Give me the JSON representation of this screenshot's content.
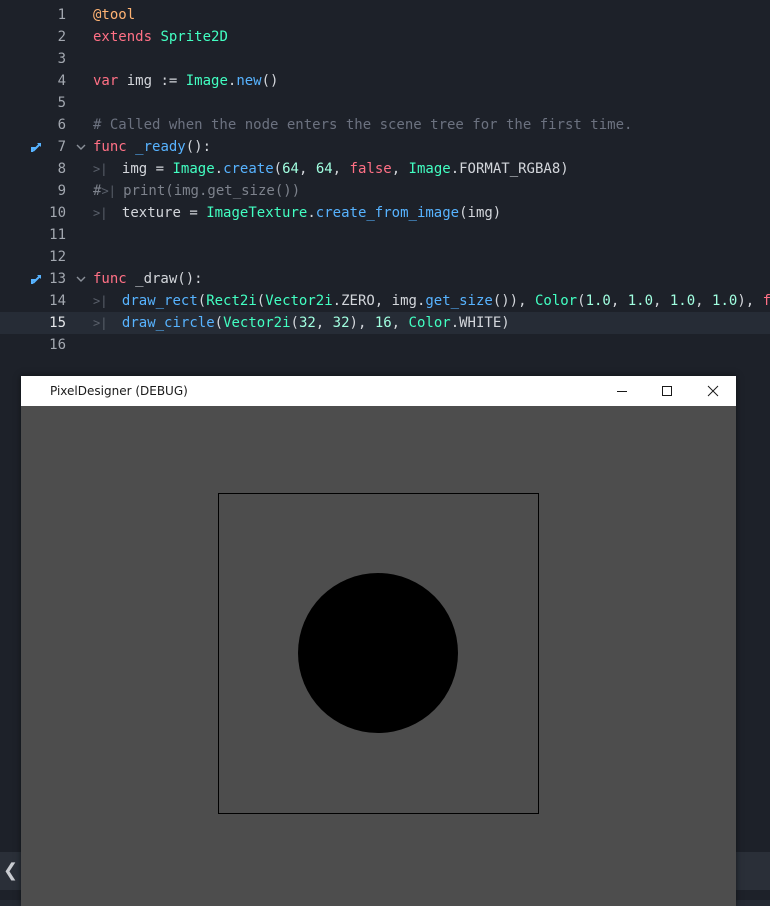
{
  "editor": {
    "lines": [
      {
        "n": "1",
        "tokens": [
          {
            "c": "an",
            "t": "@tool"
          }
        ]
      },
      {
        "n": "2",
        "tokens": [
          {
            "c": "kw",
            "t": "extends"
          },
          {
            "c": "pl",
            "t": " "
          },
          {
            "c": "ty",
            "t": "Sprite2D"
          }
        ]
      },
      {
        "n": "3",
        "tokens": []
      },
      {
        "n": "4",
        "tokens": [
          {
            "c": "kw",
            "t": "var"
          },
          {
            "c": "pl",
            "t": " img := "
          },
          {
            "c": "ty",
            "t": "Image"
          },
          {
            "c": "pl",
            "t": "."
          },
          {
            "c": "fn",
            "t": "new"
          },
          {
            "c": "pl",
            "t": "()"
          }
        ]
      },
      {
        "n": "5",
        "tokens": []
      },
      {
        "n": "6",
        "tokens": [
          {
            "c": "cm",
            "t": "# Called when the node enters the scene tree for the first time."
          }
        ]
      },
      {
        "n": "7",
        "override": true,
        "fold": true,
        "tokens": [
          {
            "c": "kw",
            "t": "func"
          },
          {
            "c": "pl",
            "t": " "
          },
          {
            "c": "fn",
            "t": "_ready"
          },
          {
            "c": "pl",
            "t": "():"
          }
        ]
      },
      {
        "n": "8",
        "tab": true,
        "tokens": [
          {
            "c": "pl",
            "t": "img = "
          },
          {
            "c": "ty",
            "t": "Image"
          },
          {
            "c": "pl",
            "t": "."
          },
          {
            "c": "fn",
            "t": "create"
          },
          {
            "c": "pl",
            "t": "("
          },
          {
            "c": "num",
            "t": "64"
          },
          {
            "c": "pl",
            "t": ", "
          },
          {
            "c": "num",
            "t": "64"
          },
          {
            "c": "pl",
            "t": ", "
          },
          {
            "c": "kw",
            "t": "false"
          },
          {
            "c": "pl",
            "t": ", "
          },
          {
            "c": "ty",
            "t": "Image"
          },
          {
            "c": "pl",
            "t": ".FORMAT_RGBA8)"
          }
        ]
      },
      {
        "n": "9",
        "hash": true,
        "tokens": [
          {
            "c": "cm2",
            "t": "print(img.get_size())"
          }
        ]
      },
      {
        "n": "10",
        "tab": true,
        "tokens": [
          {
            "c": "pl",
            "t": "texture = "
          },
          {
            "c": "ty",
            "t": "ImageTexture"
          },
          {
            "c": "pl",
            "t": "."
          },
          {
            "c": "fn",
            "t": "create_from_image"
          },
          {
            "c": "pl",
            "t": "(img)"
          }
        ]
      },
      {
        "n": "11",
        "tokens": []
      },
      {
        "n": "12",
        "tokens": []
      },
      {
        "n": "13",
        "override": true,
        "fold": true,
        "tokens": [
          {
            "c": "kw",
            "t": "func"
          },
          {
            "c": "pl",
            "t": " _draw():"
          }
        ]
      },
      {
        "n": "14",
        "tab": true,
        "tokens": [
          {
            "c": "fn",
            "t": "draw_rect"
          },
          {
            "c": "pl",
            "t": "("
          },
          {
            "c": "ty",
            "t": "Rect2i"
          },
          {
            "c": "pl",
            "t": "("
          },
          {
            "c": "ty",
            "t": "Vector2i"
          },
          {
            "c": "pl",
            "t": ".ZERO, img."
          },
          {
            "c": "fn",
            "t": "get_size"
          },
          {
            "c": "pl",
            "t": "()), "
          },
          {
            "c": "ty",
            "t": "Color"
          },
          {
            "c": "pl",
            "t": "("
          },
          {
            "c": "num",
            "t": "1.0"
          },
          {
            "c": "pl",
            "t": ", "
          },
          {
            "c": "num",
            "t": "1.0"
          },
          {
            "c": "pl",
            "t": ", "
          },
          {
            "c": "num",
            "t": "1.0"
          },
          {
            "c": "pl",
            "t": ", "
          },
          {
            "c": "num",
            "t": "1.0"
          },
          {
            "c": "pl",
            "t": "), "
          },
          {
            "c": "kw",
            "t": "f"
          }
        ]
      },
      {
        "n": "15",
        "tab": true,
        "current": true,
        "tokens": [
          {
            "c": "fn",
            "t": "draw_circle"
          },
          {
            "c": "pl",
            "t": "("
          },
          {
            "c": "ty",
            "t": "Vector2i"
          },
          {
            "c": "pl",
            "t": "("
          },
          {
            "c": "num",
            "t": "32"
          },
          {
            "c": "pl",
            "t": ", "
          },
          {
            "c": "num",
            "t": "32"
          },
          {
            "c": "pl",
            "t": "), "
          },
          {
            "c": "num",
            "t": "16"
          },
          {
            "c": "pl",
            "t": ", "
          },
          {
            "c": "ty",
            "t": "Color"
          },
          {
            "c": "pl",
            "t": ".WHITE)"
          }
        ]
      },
      {
        "n": "16",
        "tokens": []
      }
    ],
    "left_arrow_glyph": "❮"
  },
  "window": {
    "title": "PixelDesigner (DEBUG)",
    "buttons": [
      "minimize-icon",
      "maximize-icon",
      "close-icon"
    ],
    "canvas_background": "#4d4d4d"
  },
  "colors": {
    "editor_bg": "#1d2129",
    "current_line_bg": "#262c36",
    "keyword": "#ff7085",
    "type": "#42ffc2",
    "function": "#57b3ff",
    "number": "#a1ffe0",
    "comment": "#6c7280",
    "annotation": "#ffb373"
  }
}
